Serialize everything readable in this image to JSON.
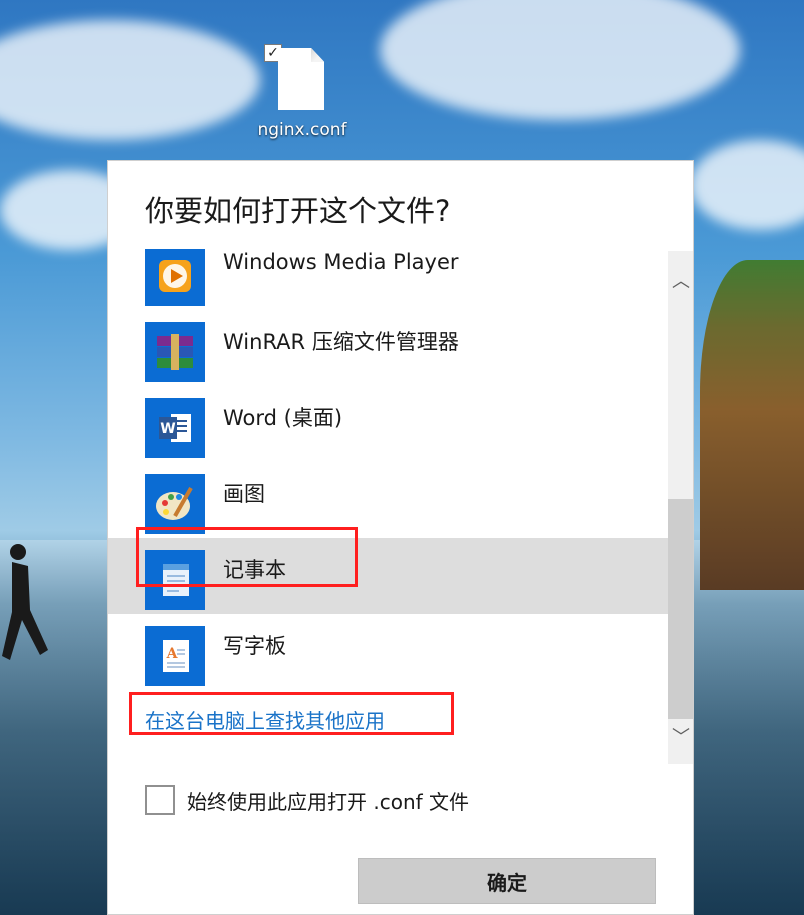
{
  "desktop": {
    "file_name": "nginx.conf",
    "file_checked": true
  },
  "dialog": {
    "title": "你要如何打开这个文件?",
    "apps": [
      {
        "label": "Windows Media Player",
        "icon": "windows-media-player-icon",
        "selected": false
      },
      {
        "label": "WinRAR 压缩文件管理器",
        "icon": "winrar-icon",
        "selected": false
      },
      {
        "label": "Word (桌面)",
        "icon": "word-icon",
        "selected": false
      },
      {
        "label": "画图",
        "icon": "paint-icon",
        "selected": false
      },
      {
        "label": "记事本",
        "icon": "notepad-icon",
        "selected": true
      },
      {
        "label": "写字板",
        "icon": "wordpad-icon",
        "selected": false
      }
    ],
    "more_apps_link": "在这台电脑上查找其他应用",
    "always_use_label": "始终使用此应用打开 .conf 文件",
    "always_use_checked": false,
    "ok_label": "确定"
  },
  "colors": {
    "selection_background": "#dddddd",
    "link": "#1a73c8",
    "highlight": "#ff1f1f",
    "app_tile": "#0b6cd3"
  }
}
